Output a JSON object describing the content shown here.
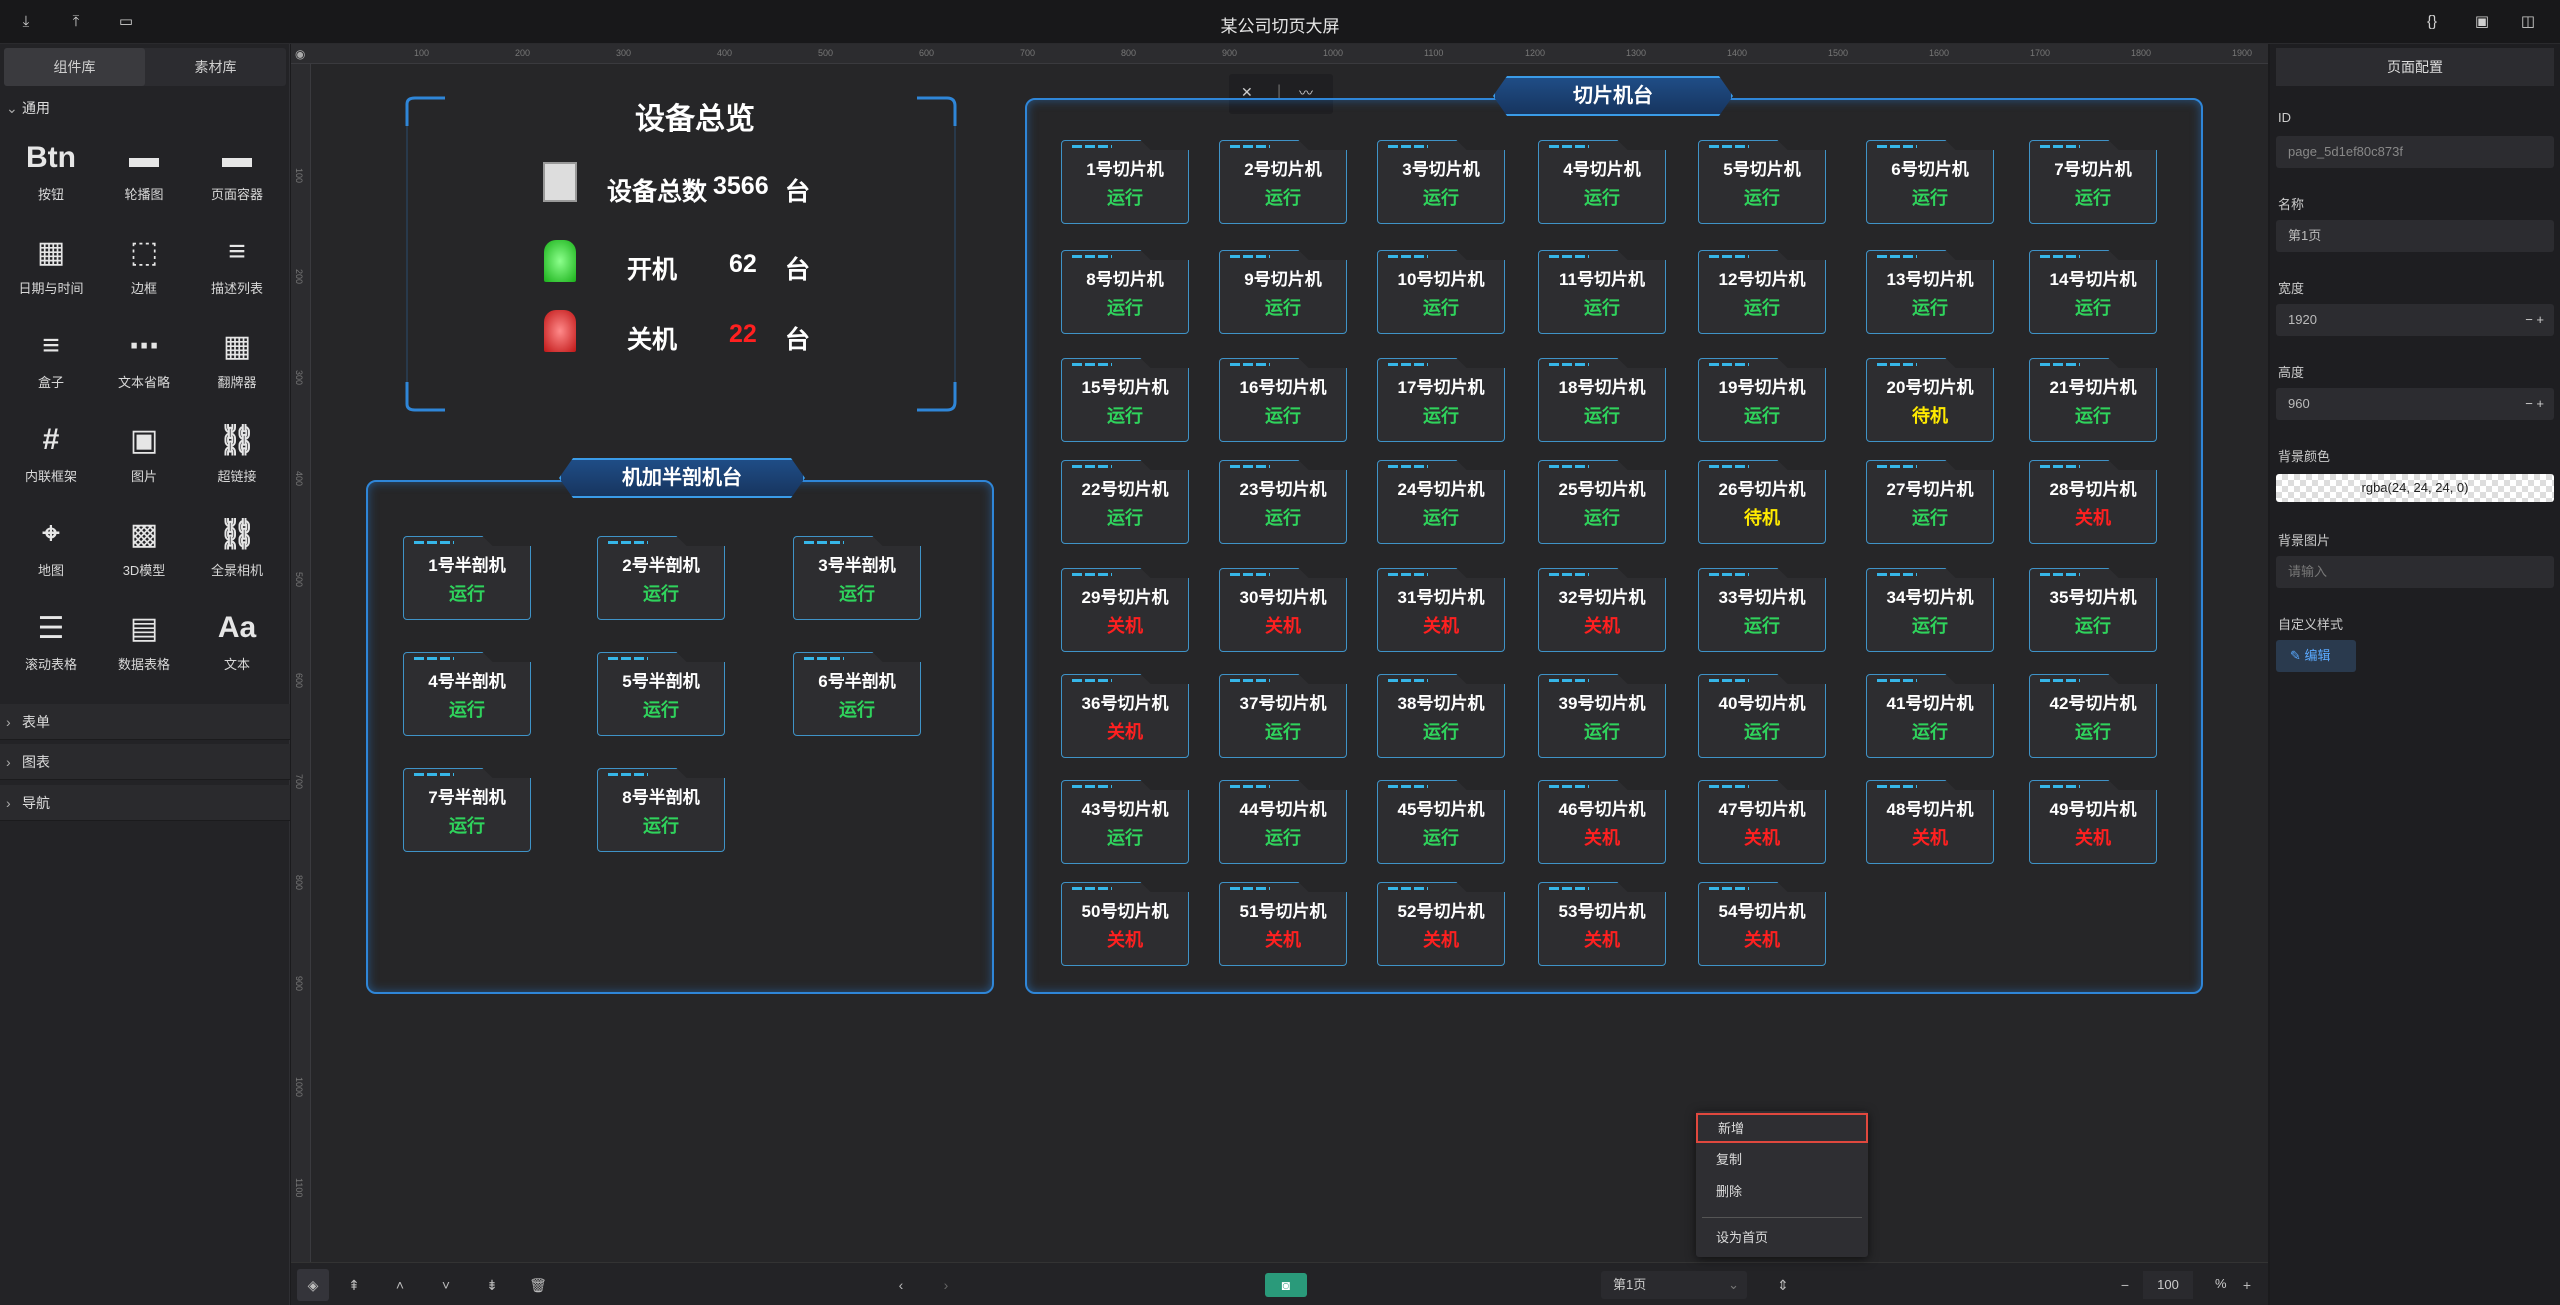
{
  "app": {
    "title": "某公司切页大屏"
  },
  "left": {
    "tabs": [
      "组件库",
      "素材库"
    ],
    "sections": {
      "general": "通用",
      "form": "表单",
      "chart": "图表",
      "nav": "导航"
    },
    "components": [
      "按钮",
      "轮播图",
      "页面容器",
      "日期与时间",
      "边框",
      "描述列表",
      "盒子",
      "文本省略",
      "翻牌器",
      "内联框架",
      "图片",
      "超链接",
      "地图",
      "3D模型",
      "全景相机",
      "滚动表格",
      "数据表格",
      "文本"
    ]
  },
  "overview": {
    "title": "设备总览",
    "total_label": "设备总数",
    "total_value": "3566",
    "unit": "台",
    "on_label": "开机",
    "on_value": "62",
    "off_label": "关机",
    "off_value": "22"
  },
  "semi": {
    "title": "机加半剖机台",
    "items": [
      {
        "name": "1号半剖机",
        "status": "运行"
      },
      {
        "name": "2号半剖机",
        "status": "运行"
      },
      {
        "name": "3号半剖机",
        "status": "运行"
      },
      {
        "name": "4号半剖机",
        "status": "运行"
      },
      {
        "name": "5号半剖机",
        "status": "运行"
      },
      {
        "name": "6号半剖机",
        "status": "运行"
      },
      {
        "name": "7号半剖机",
        "status": "运行"
      },
      {
        "name": "8号半剖机",
        "status": "运行"
      }
    ]
  },
  "slicer": {
    "title": "切片机台",
    "statuses": [
      "运行",
      "运行",
      "运行",
      "运行",
      "运行",
      "运行",
      "运行",
      "运行",
      "运行",
      "运行",
      "运行",
      "运行",
      "运行",
      "运行",
      "运行",
      "运行",
      "运行",
      "运行",
      "运行",
      "待机",
      "运行",
      "运行",
      "运行",
      "运行",
      "运行",
      "待机",
      "运行",
      "关机",
      "关机",
      "关机",
      "关机",
      "关机",
      "运行",
      "运行",
      "运行",
      "关机",
      "运行",
      "运行",
      "运行",
      "运行",
      "运行",
      "运行",
      "运行",
      "运行",
      "运行",
      "关机",
      "关机",
      "关机",
      "关机",
      "关机",
      "关机",
      "关机",
      "关机",
      "关机"
    ],
    "suffix": "号切片机"
  },
  "status_colors": {
    "运行": "#2fd35c",
    "关机": "#ff2020",
    "待机": "#ffea00"
  },
  "right": {
    "header": "页面配置",
    "id_label": "ID",
    "id_value": "page_5d1ef80c873f",
    "name_label": "名称",
    "name_value": "第1页",
    "width_label": "宽度",
    "width_value": "1920",
    "height_label": "高度",
    "height_value": "960",
    "bg_color_label": "背景颜色",
    "bg_color_value": "rgba(24, 24, 24, 0)",
    "bg_image_label": "背景图片",
    "bg_image_placeholder": "请输入",
    "custom_style_label": "自定义样式",
    "edit_button": "编辑"
  },
  "bottom": {
    "page_select": "第1页",
    "zoom": "100",
    "zoom_unit": "%"
  },
  "context_menu": [
    "新增",
    "复制",
    "删除",
    "设为首页"
  ],
  "ruler": {
    "h": [
      "100",
      "200",
      "300",
      "400",
      "500",
      "600",
      "700",
      "800",
      "900",
      "1000",
      "1100",
      "1200",
      "1300",
      "1400",
      "1500",
      "1600",
      "1700",
      "1800",
      "1900"
    ],
    "v": [
      "100",
      "200",
      "300",
      "400",
      "500",
      "600",
      "700",
      "800",
      "900",
      "1000",
      "1100"
    ]
  }
}
